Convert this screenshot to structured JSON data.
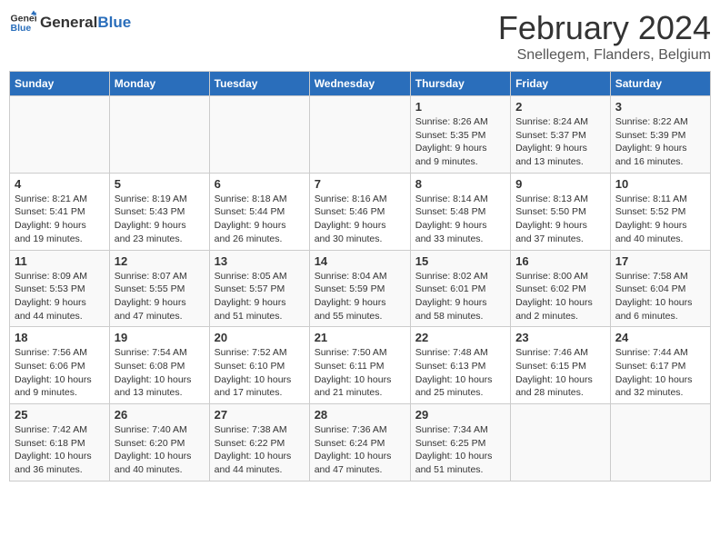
{
  "logo": {
    "general": "General",
    "blue": "Blue"
  },
  "title": "February 2024",
  "subtitle": "Snellegem, Flanders, Belgium",
  "days_of_week": [
    "Sunday",
    "Monday",
    "Tuesday",
    "Wednesday",
    "Thursday",
    "Friday",
    "Saturday"
  ],
  "weeks": [
    [
      {
        "day": "",
        "info": ""
      },
      {
        "day": "",
        "info": ""
      },
      {
        "day": "",
        "info": ""
      },
      {
        "day": "",
        "info": ""
      },
      {
        "day": "1",
        "info": "Sunrise: 8:26 AM\nSunset: 5:35 PM\nDaylight: 9 hours\nand 9 minutes."
      },
      {
        "day": "2",
        "info": "Sunrise: 8:24 AM\nSunset: 5:37 PM\nDaylight: 9 hours\nand 13 minutes."
      },
      {
        "day": "3",
        "info": "Sunrise: 8:22 AM\nSunset: 5:39 PM\nDaylight: 9 hours\nand 16 minutes."
      }
    ],
    [
      {
        "day": "4",
        "info": "Sunrise: 8:21 AM\nSunset: 5:41 PM\nDaylight: 9 hours\nand 19 minutes."
      },
      {
        "day": "5",
        "info": "Sunrise: 8:19 AM\nSunset: 5:43 PM\nDaylight: 9 hours\nand 23 minutes."
      },
      {
        "day": "6",
        "info": "Sunrise: 8:18 AM\nSunset: 5:44 PM\nDaylight: 9 hours\nand 26 minutes."
      },
      {
        "day": "7",
        "info": "Sunrise: 8:16 AM\nSunset: 5:46 PM\nDaylight: 9 hours\nand 30 minutes."
      },
      {
        "day": "8",
        "info": "Sunrise: 8:14 AM\nSunset: 5:48 PM\nDaylight: 9 hours\nand 33 minutes."
      },
      {
        "day": "9",
        "info": "Sunrise: 8:13 AM\nSunset: 5:50 PM\nDaylight: 9 hours\nand 37 minutes."
      },
      {
        "day": "10",
        "info": "Sunrise: 8:11 AM\nSunset: 5:52 PM\nDaylight: 9 hours\nand 40 minutes."
      }
    ],
    [
      {
        "day": "11",
        "info": "Sunrise: 8:09 AM\nSunset: 5:53 PM\nDaylight: 9 hours\nand 44 minutes."
      },
      {
        "day": "12",
        "info": "Sunrise: 8:07 AM\nSunset: 5:55 PM\nDaylight: 9 hours\nand 47 minutes."
      },
      {
        "day": "13",
        "info": "Sunrise: 8:05 AM\nSunset: 5:57 PM\nDaylight: 9 hours\nand 51 minutes."
      },
      {
        "day": "14",
        "info": "Sunrise: 8:04 AM\nSunset: 5:59 PM\nDaylight: 9 hours\nand 55 minutes."
      },
      {
        "day": "15",
        "info": "Sunrise: 8:02 AM\nSunset: 6:01 PM\nDaylight: 9 hours\nand 58 minutes."
      },
      {
        "day": "16",
        "info": "Sunrise: 8:00 AM\nSunset: 6:02 PM\nDaylight: 10 hours\nand 2 minutes."
      },
      {
        "day": "17",
        "info": "Sunrise: 7:58 AM\nSunset: 6:04 PM\nDaylight: 10 hours\nand 6 minutes."
      }
    ],
    [
      {
        "day": "18",
        "info": "Sunrise: 7:56 AM\nSunset: 6:06 PM\nDaylight: 10 hours\nand 9 minutes."
      },
      {
        "day": "19",
        "info": "Sunrise: 7:54 AM\nSunset: 6:08 PM\nDaylight: 10 hours\nand 13 minutes."
      },
      {
        "day": "20",
        "info": "Sunrise: 7:52 AM\nSunset: 6:10 PM\nDaylight: 10 hours\nand 17 minutes."
      },
      {
        "day": "21",
        "info": "Sunrise: 7:50 AM\nSunset: 6:11 PM\nDaylight: 10 hours\nand 21 minutes."
      },
      {
        "day": "22",
        "info": "Sunrise: 7:48 AM\nSunset: 6:13 PM\nDaylight: 10 hours\nand 25 minutes."
      },
      {
        "day": "23",
        "info": "Sunrise: 7:46 AM\nSunset: 6:15 PM\nDaylight: 10 hours\nand 28 minutes."
      },
      {
        "day": "24",
        "info": "Sunrise: 7:44 AM\nSunset: 6:17 PM\nDaylight: 10 hours\nand 32 minutes."
      }
    ],
    [
      {
        "day": "25",
        "info": "Sunrise: 7:42 AM\nSunset: 6:18 PM\nDaylight: 10 hours\nand 36 minutes."
      },
      {
        "day": "26",
        "info": "Sunrise: 7:40 AM\nSunset: 6:20 PM\nDaylight: 10 hours\nand 40 minutes."
      },
      {
        "day": "27",
        "info": "Sunrise: 7:38 AM\nSunset: 6:22 PM\nDaylight: 10 hours\nand 44 minutes."
      },
      {
        "day": "28",
        "info": "Sunrise: 7:36 AM\nSunset: 6:24 PM\nDaylight: 10 hours\nand 47 minutes."
      },
      {
        "day": "29",
        "info": "Sunrise: 7:34 AM\nSunset: 6:25 PM\nDaylight: 10 hours\nand 51 minutes."
      },
      {
        "day": "",
        "info": ""
      },
      {
        "day": "",
        "info": ""
      }
    ]
  ]
}
